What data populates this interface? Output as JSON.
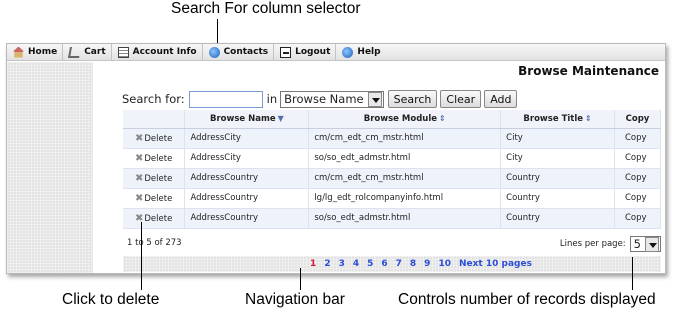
{
  "callouts": {
    "search_selector": "Search For column selector",
    "click_delete": "Click to delete",
    "nav_bar": "Navigation bar",
    "records": "Controls number of records displayed"
  },
  "menu": [
    {
      "label": "Home",
      "icon": "home-icon"
    },
    {
      "label": "Cart",
      "icon": "cart-icon"
    },
    {
      "label": "Account Info",
      "icon": "account-icon"
    },
    {
      "label": "Contacts",
      "icon": "contacts-icon"
    },
    {
      "label": "Logout",
      "icon": "logout-icon"
    },
    {
      "label": "Help",
      "icon": "help-icon"
    }
  ],
  "page_title": "Browse Maintenance",
  "search": {
    "label": "Search for:",
    "value": "",
    "in_label": "in",
    "column_selected": "Browse Name",
    "buttons": {
      "search": "Search",
      "clear": "Clear",
      "add": "Add"
    }
  },
  "table": {
    "headers": {
      "name": "Browse Name",
      "module": "Browse Module",
      "title": "Browse Title",
      "copy": "Copy"
    },
    "rows": [
      {
        "delete": "Delete",
        "name": "AddressCity",
        "module": "cm/cm_edt_cm_mstr.html",
        "title": "City",
        "copy": "Copy"
      },
      {
        "delete": "Delete",
        "name": "AddressCity",
        "module": "so/so_edt_admstr.html",
        "title": "City",
        "copy": "Copy"
      },
      {
        "delete": "Delete",
        "name": "AddressCountry",
        "module": "cm/cm_edt_cm_mstr.html",
        "title": "Country",
        "copy": "Copy"
      },
      {
        "delete": "Delete",
        "name": "AddressCountry",
        "module": "lg/lg_edt_rolcompanyinfo.html",
        "title": "Country",
        "copy": "Copy"
      },
      {
        "delete": "Delete",
        "name": "AddressCountry",
        "module": "so/so_edt_admstr.html",
        "title": "Country",
        "copy": "Copy"
      }
    ]
  },
  "footer": {
    "range": "1 to 5 of 273",
    "lines_label": "Lines per page:",
    "lines_value": "5"
  },
  "pagination": {
    "pages": [
      "1",
      "2",
      "3",
      "4",
      "5",
      "6",
      "7",
      "8",
      "9",
      "10"
    ],
    "current": "1",
    "next": "Next 10 pages"
  },
  "colors": {
    "link": "#2a4fd6",
    "current_page": "#d4143c"
  }
}
